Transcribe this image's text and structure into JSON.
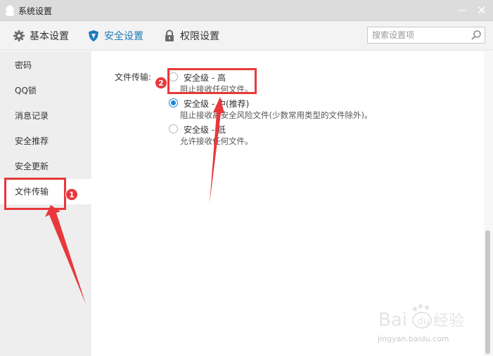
{
  "window": {
    "title": "系统设置",
    "minimize": "—",
    "close": "✕"
  },
  "toolbar": {
    "tabs": [
      {
        "label": "基本设置",
        "icon": "gear-icon"
      },
      {
        "label": "安全设置",
        "icon": "shield-icon",
        "active": true
      },
      {
        "label": "权限设置",
        "icon": "lock-icon"
      }
    ],
    "search_placeholder": "搜索设置项"
  },
  "sidebar": {
    "items": [
      {
        "label": "密码"
      },
      {
        "label": "QQ锁"
      },
      {
        "label": "消息记录"
      },
      {
        "label": "安全推荐"
      },
      {
        "label": "安全更新"
      },
      {
        "label": "文件传输",
        "active": true
      }
    ]
  },
  "file_transfer": {
    "label": "文件传输:",
    "options": [
      {
        "title": "安全级 - 高",
        "desc": "阻止接收任何文件。",
        "selected": false
      },
      {
        "title": "安全级 - 中(推荐)",
        "desc": "阻止接收高安全风险文件(少数常用类型的文件除外)。",
        "selected": true
      },
      {
        "title": "安全级 - 低",
        "desc": "允许接收任何文件。",
        "selected": false
      }
    ]
  },
  "annotations": {
    "badge1": "1",
    "badge2": "2",
    "color": "#e8383b"
  },
  "watermark": {
    "text": "jingyan.baidu.com"
  },
  "colors": {
    "accent": "#1f7ab8",
    "radio_checked": "#1f86d4"
  }
}
